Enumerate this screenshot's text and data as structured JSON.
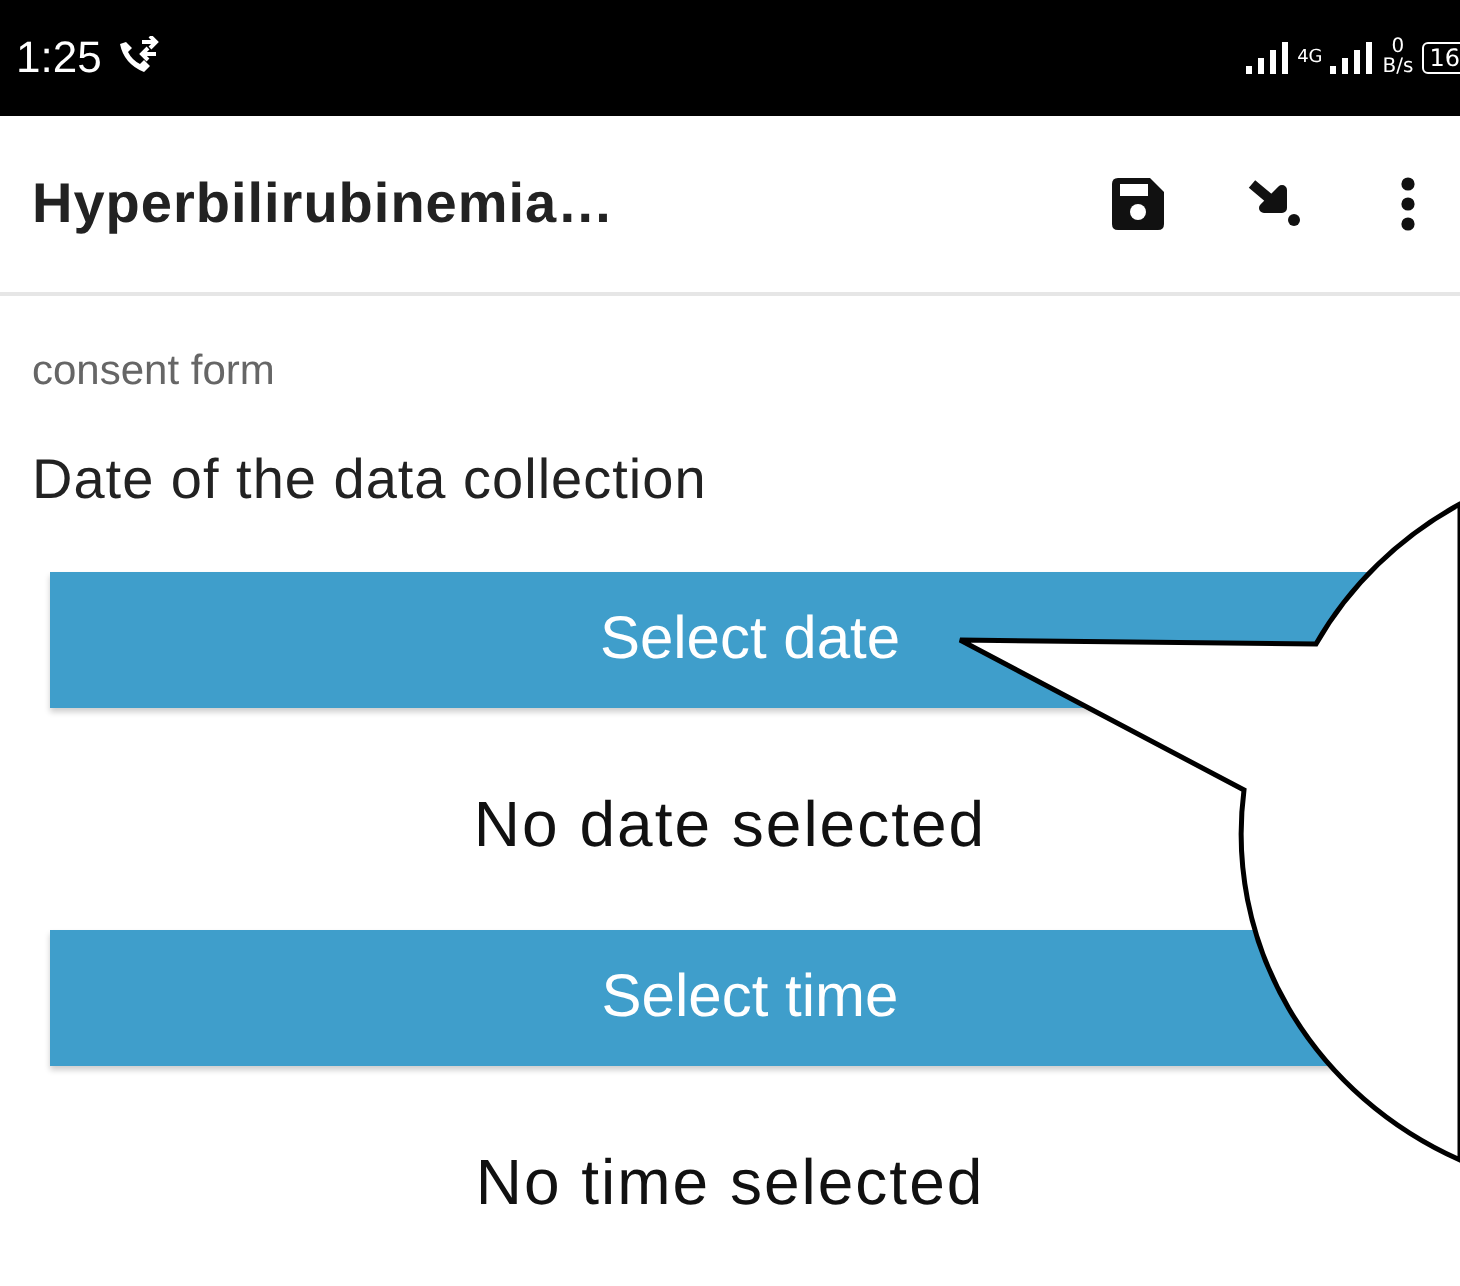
{
  "status_bar": {
    "time": "1:25",
    "network": "4G",
    "speed_value": "0",
    "speed_unit": "B/s",
    "battery": "16"
  },
  "toolbar": {
    "title": "Hyperbilirubinemia…"
  },
  "form": {
    "section": "consent form",
    "question": "Date of the data collection",
    "fields": [
      {
        "button": "Select date",
        "value": "No date selected"
      },
      {
        "button": "Select time",
        "value": "No time selected"
      }
    ]
  }
}
